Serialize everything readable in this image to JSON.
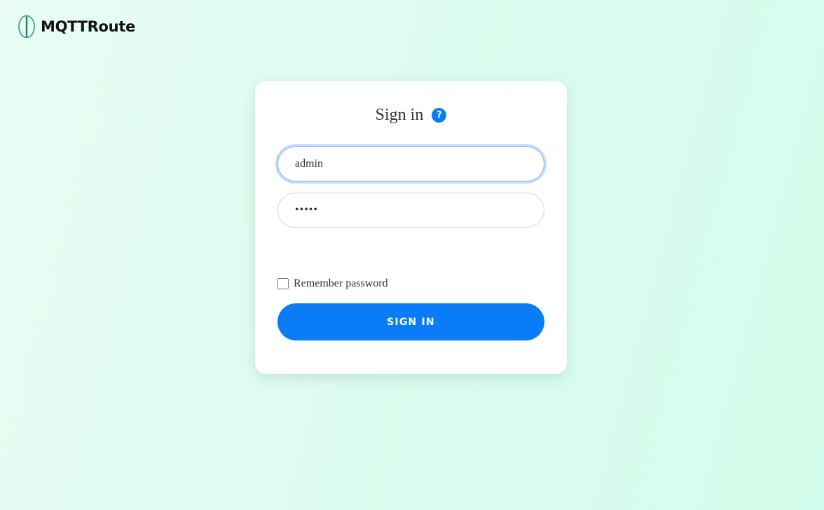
{
  "brand": {
    "name": "MQTTRoute",
    "logo_icon": "mqttroute-logo-icon",
    "accent_color": "#2a9d7f"
  },
  "login": {
    "title": "Sign in",
    "help_icon": "help-icon",
    "help_glyph": "?",
    "username_value": "admin",
    "password_value": "•••••",
    "remember_label": "Remember password",
    "remember_checked": false,
    "submit_label": "SIGN IN",
    "primary_color": "#0a7cf8"
  }
}
